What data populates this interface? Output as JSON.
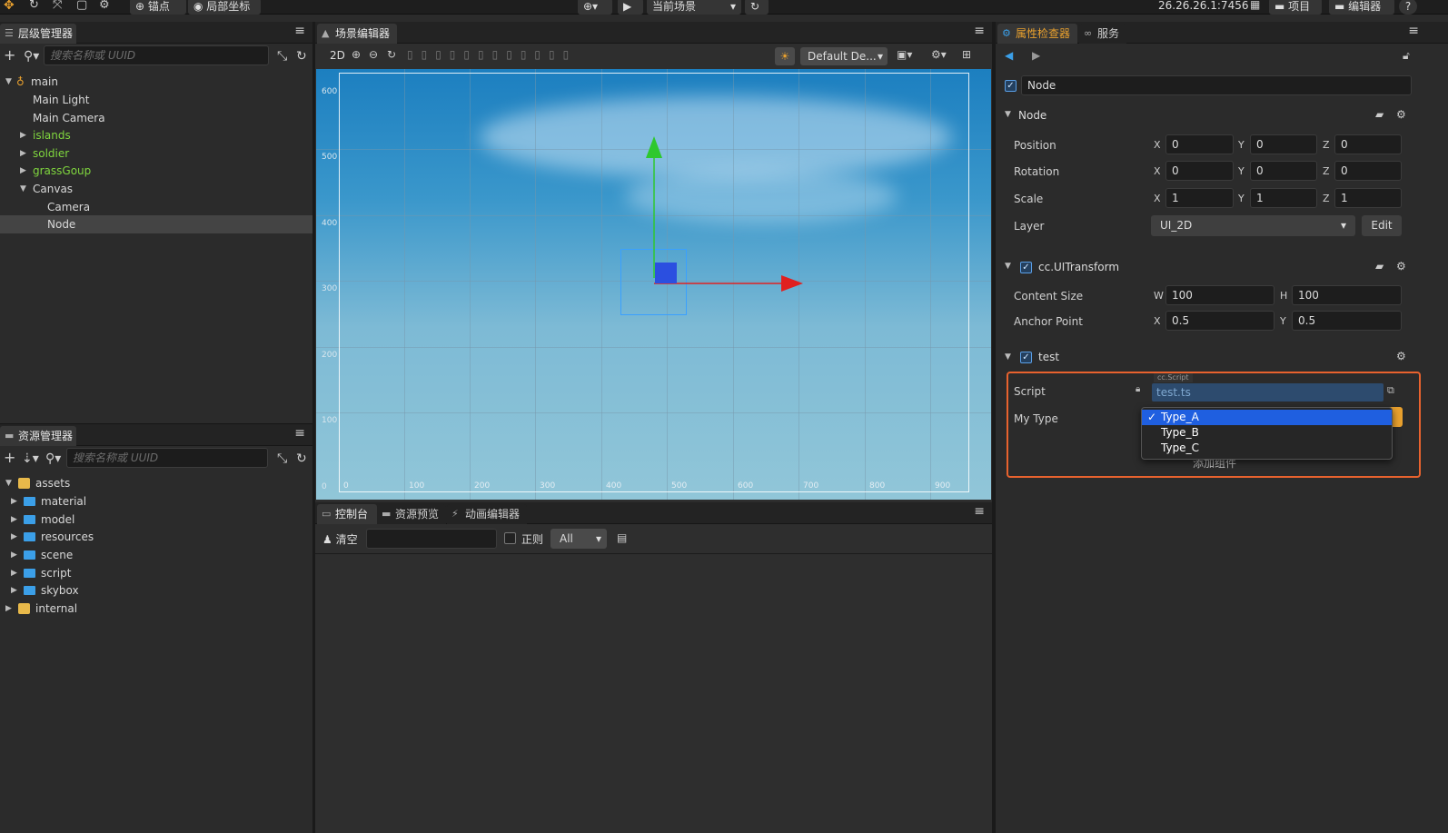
{
  "topbar": {
    "anchor": "锚点",
    "local_coord": "局部坐标",
    "scene_select": "当前场景",
    "ip": "26.26.26.1:7456",
    "project": "项目",
    "editor": "编辑器",
    "help": "?"
  },
  "hierarchy": {
    "title": "层级管理器",
    "search_placeholder": "搜索名称或 UUID",
    "items": [
      {
        "label": "main"
      },
      {
        "label": "Main Light"
      },
      {
        "label": "Main Camera"
      },
      {
        "label": "islands"
      },
      {
        "label": "soldier"
      },
      {
        "label": "grassGoup"
      },
      {
        "label": "Canvas"
      },
      {
        "label": "Camera"
      },
      {
        "label": "Node"
      }
    ]
  },
  "assets": {
    "title": "资源管理器",
    "search_placeholder": "搜索名称或 UUID",
    "items": [
      {
        "label": "assets"
      },
      {
        "label": "material"
      },
      {
        "label": "model"
      },
      {
        "label": "resources"
      },
      {
        "label": "scene"
      },
      {
        "label": "script"
      },
      {
        "label": "skybox"
      },
      {
        "label": "internal"
      }
    ]
  },
  "scene": {
    "title": "场景编辑器",
    "mode": "2D",
    "camera_select": "Default De...",
    "y_ticks": [
      "600",
      "500",
      "400",
      "300",
      "200",
      "100",
      "0"
    ],
    "x_ticks": [
      "0",
      "100",
      "200",
      "300",
      "400",
      "500",
      "600",
      "700",
      "800",
      "900"
    ]
  },
  "console": {
    "tabs": [
      "控制台",
      "资源预览",
      "动画编辑器"
    ],
    "clear": "清空",
    "regex": "正则",
    "level": "All"
  },
  "inspector": {
    "tabs": [
      "属性检查器",
      "服务"
    ],
    "node_name": "Node",
    "node_section": "Node",
    "position": {
      "label": "Position",
      "x": "0",
      "y": "0",
      "z": "0"
    },
    "rotation": {
      "label": "Rotation",
      "x": "0",
      "y": "0",
      "z": "0"
    },
    "scale": {
      "label": "Scale",
      "x": "1",
      "y": "1",
      "z": "1"
    },
    "layer": {
      "label": "Layer",
      "value": "UI_2D",
      "edit": "Edit"
    },
    "uitransform": {
      "title": "cc.UITransform",
      "content_size": {
        "label": "Content Size",
        "w": "100",
        "h": "100"
      },
      "anchor_point": {
        "label": "Anchor Point",
        "x": "0.5",
        "y": "0.5"
      }
    },
    "test": {
      "title": "test",
      "script_label": "Script",
      "script_type": "cc.Script",
      "script_value": "test.ts",
      "my_type_label": "My Type",
      "options": [
        "Type_A",
        "Type_B",
        "Type_C"
      ],
      "selected": "Type_A",
      "add_component": "添加组件"
    },
    "axis": {
      "x": "X",
      "y": "Y",
      "z": "Z",
      "w": "W",
      "h": "H"
    }
  },
  "colors": {
    "accent": "#3b9fe8",
    "highlight": "#e8622e",
    "green_node": "#7fd53e",
    "select_blue": "#1f5fe0"
  }
}
